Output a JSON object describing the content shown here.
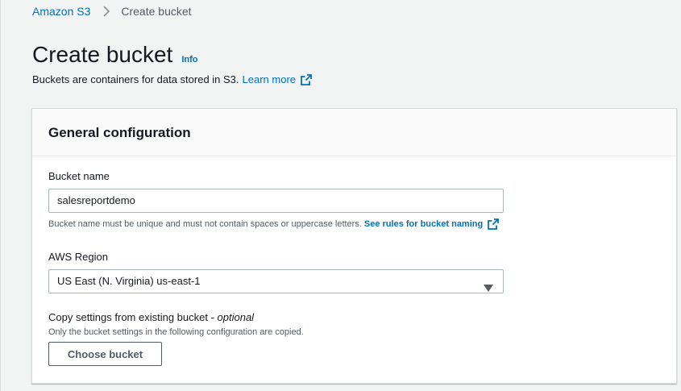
{
  "breadcrumb": {
    "items": [
      {
        "label": "Amazon S3"
      },
      {
        "label": "Create bucket"
      }
    ]
  },
  "header": {
    "title": "Create bucket",
    "info_label": "Info",
    "description": "Buckets are containers for data stored in S3.",
    "learn_more_label": "Learn more"
  },
  "general_config": {
    "title": "General configuration",
    "bucket_name": {
      "label": "Bucket name",
      "value": "salesreportdemo",
      "hint": "Bucket name must be unique and must not contain spaces or uppercase letters.",
      "rules_link": "See rules for bucket naming"
    },
    "region": {
      "label": "AWS Region",
      "selected": "US East (N. Virginia) us-east-1"
    },
    "copy_settings": {
      "label": "Copy settings from existing bucket - ",
      "optional": "optional",
      "hint": "Only the bucket settings in the following configuration are copied.",
      "button_label": "Choose bucket"
    }
  },
  "colors": {
    "link": "#0073bb",
    "text": "#16191f",
    "muted": "#545b64",
    "background": "#f2f3f3"
  },
  "icons": [
    "chevron-right-icon",
    "external-link-icon",
    "caret-down-icon"
  ]
}
